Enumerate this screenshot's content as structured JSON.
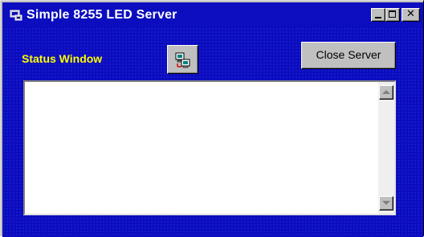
{
  "window": {
    "title": "Simple 8255 LED Server",
    "title_icon": "app-window-icon",
    "controls": {
      "minimize_icon": "minimize-icon",
      "maximize_icon": "maximize-icon",
      "close_icon": "close-icon",
      "close_glyph": "✕"
    }
  },
  "main": {
    "status_label": "Status Window",
    "network_button_icon": "network-computer-icon",
    "close_server_label": "Close Server",
    "status_text": ""
  },
  "colors": {
    "title_bar": "#0b0dbf",
    "client_background": "#0b0cbd",
    "status_label": "#ffff00",
    "button_face": "#c0c0c0",
    "text_area_background": "#ffffff"
  }
}
